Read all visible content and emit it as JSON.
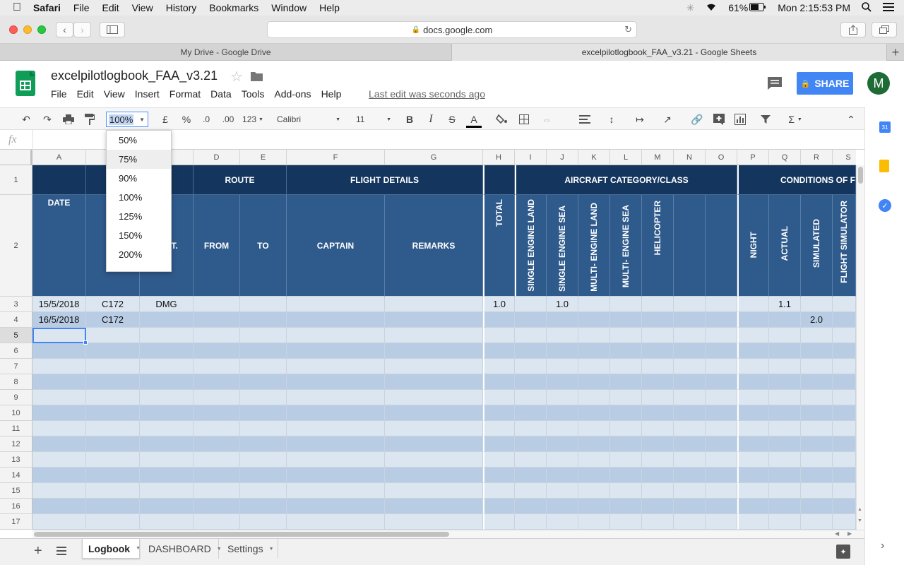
{
  "macbar": {
    "app": "Safari",
    "menus": [
      "File",
      "Edit",
      "View",
      "History",
      "Bookmarks",
      "Window",
      "Help"
    ],
    "battery": "61%",
    "clock": "Mon 2:15:53 PM"
  },
  "browser": {
    "url": "docs.google.com",
    "tabs": [
      {
        "title": "My Drive - Google Drive",
        "active": false
      },
      {
        "title": "excelpilotlogbook_FAA_v3.21 - Google Sheets",
        "active": true
      }
    ]
  },
  "sheets": {
    "title": "excelpilotlogbook_FAA_v3.21",
    "menus": [
      "File",
      "Edit",
      "View",
      "Insert",
      "Format",
      "Data",
      "Tools",
      "Add-ons",
      "Help"
    ],
    "last_edit": "Last edit was seconds ago",
    "share_label": "SHARE",
    "avatar_letter": "M",
    "toolbar": {
      "zoom": "100%",
      "currency": "£",
      "percent": "%",
      "dec_less": ".0",
      "dec_more": ".00",
      "format_more": "123",
      "font": "Calibri",
      "font_size": "11",
      "bold": "B",
      "italic": "I",
      "strike": "S",
      "text_color": "A",
      "sum": "Σ"
    },
    "fx": "fx",
    "zoom_options": [
      "50%",
      "75%",
      "90%",
      "100%",
      "125%",
      "150%",
      "200%"
    ],
    "zoom_hover": "75%",
    "sheet_tabs": [
      {
        "label": "Logbook",
        "active": true
      },
      {
        "label": "DASHBOARD",
        "active": false
      },
      {
        "label": "Settings",
        "active": false
      }
    ]
  },
  "grid": {
    "columns": [
      "A",
      "D",
      "E",
      "F",
      "G",
      "H",
      "I",
      "J",
      "K",
      "L",
      "M",
      "N",
      "O",
      "P",
      "Q",
      "R",
      "S"
    ],
    "rows": [
      "1",
      "2",
      "3",
      "4",
      "5",
      "6",
      "7",
      "8",
      "9",
      "10",
      "11",
      "12",
      "13",
      "14",
      "15",
      "16",
      "17"
    ],
    "group_headers": {
      "route": "ROUTE",
      "flight_details": "FLIGHT DETAILS",
      "aircraft_category": "AIRCRAFT CATEGORY/CLASS",
      "conditions": "CONDITIONS OF F"
    },
    "sub_headers": {
      "date": "DATE",
      "type_partial": "T",
      "ident_partial": "IT.",
      "from": "FROM",
      "to": "TO",
      "captain": "CAPTAIN",
      "remarks": "REMARKS",
      "total": "TOTAL",
      "sel": "SINGLE ENGINE LAND",
      "ses": "SINGLE ENGINE SEA",
      "mel": "MULTI- ENGINE LAND",
      "mes": "MULTI- ENGINE SEA",
      "heli": "HELICOPTER",
      "night": "NIGHT",
      "actual": "ACTUAL",
      "simulated": "SIMULATED",
      "flight_sim": "FLIGHT SIMULATOR"
    },
    "data_rows": [
      {
        "date": "15/5/2018",
        "type": "C172",
        "ident": "DMG",
        "total": "1.0",
        "ses": "1.0",
        "actual": "1.1",
        "simulated": ""
      },
      {
        "date": "16/5/2018",
        "type": "C172",
        "ident": "",
        "total": "",
        "ses": "",
        "actual": "",
        "simulated": "2.0"
      }
    ]
  },
  "colors": {
    "header_dark": "#14365e",
    "header_mid": "#2f5a8c",
    "row_light": "#dce6f1",
    "row_dark": "#b8cce4",
    "share_blue": "#4285f4",
    "sheets_green": "#0f9d58"
  }
}
